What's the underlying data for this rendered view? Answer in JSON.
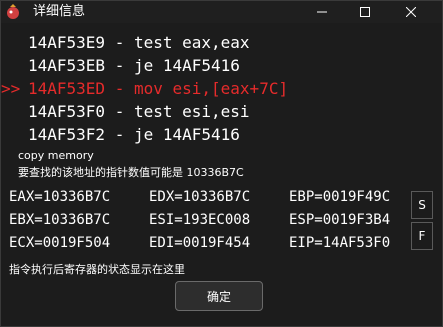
{
  "window": {
    "title": "详细信息"
  },
  "asm_lines": [
    {
      "marker": "",
      "text": "14AF53E9 - test eax,eax"
    },
    {
      "marker": "",
      "text": "14AF53EB - je 14AF5416"
    },
    {
      "marker": ">>",
      "text": "14AF53ED - mov esi,[eax+7C]"
    },
    {
      "marker": "",
      "text": "14AF53F0 - test esi,esi"
    },
    {
      "marker": "",
      "text": "14AF53F2 - je 14AF5416"
    }
  ],
  "info": {
    "copy_memory": "copy memory",
    "pointer_hint": "要查找的该地址的指针数值可能是 10336B7C"
  },
  "registers": [
    [
      "EAX=10336B7C",
      "EDX=10336B7C",
      "EBP=0019F49C"
    ],
    [
      "EBX=10336B7C",
      "ESI=193EC008",
      "ESP=0019F3B4"
    ],
    [
      "ECX=0019F504",
      "EDI=0019F454",
      "EIP=14AF53F0"
    ]
  ],
  "side_buttons": {
    "s": "S",
    "f": "F"
  },
  "status_text": "指令执行后寄存器的状态显示在这里",
  "ok_button": "确定",
  "colors": {
    "current_line": "#e62b2b",
    "background": "#1c1c1c"
  }
}
